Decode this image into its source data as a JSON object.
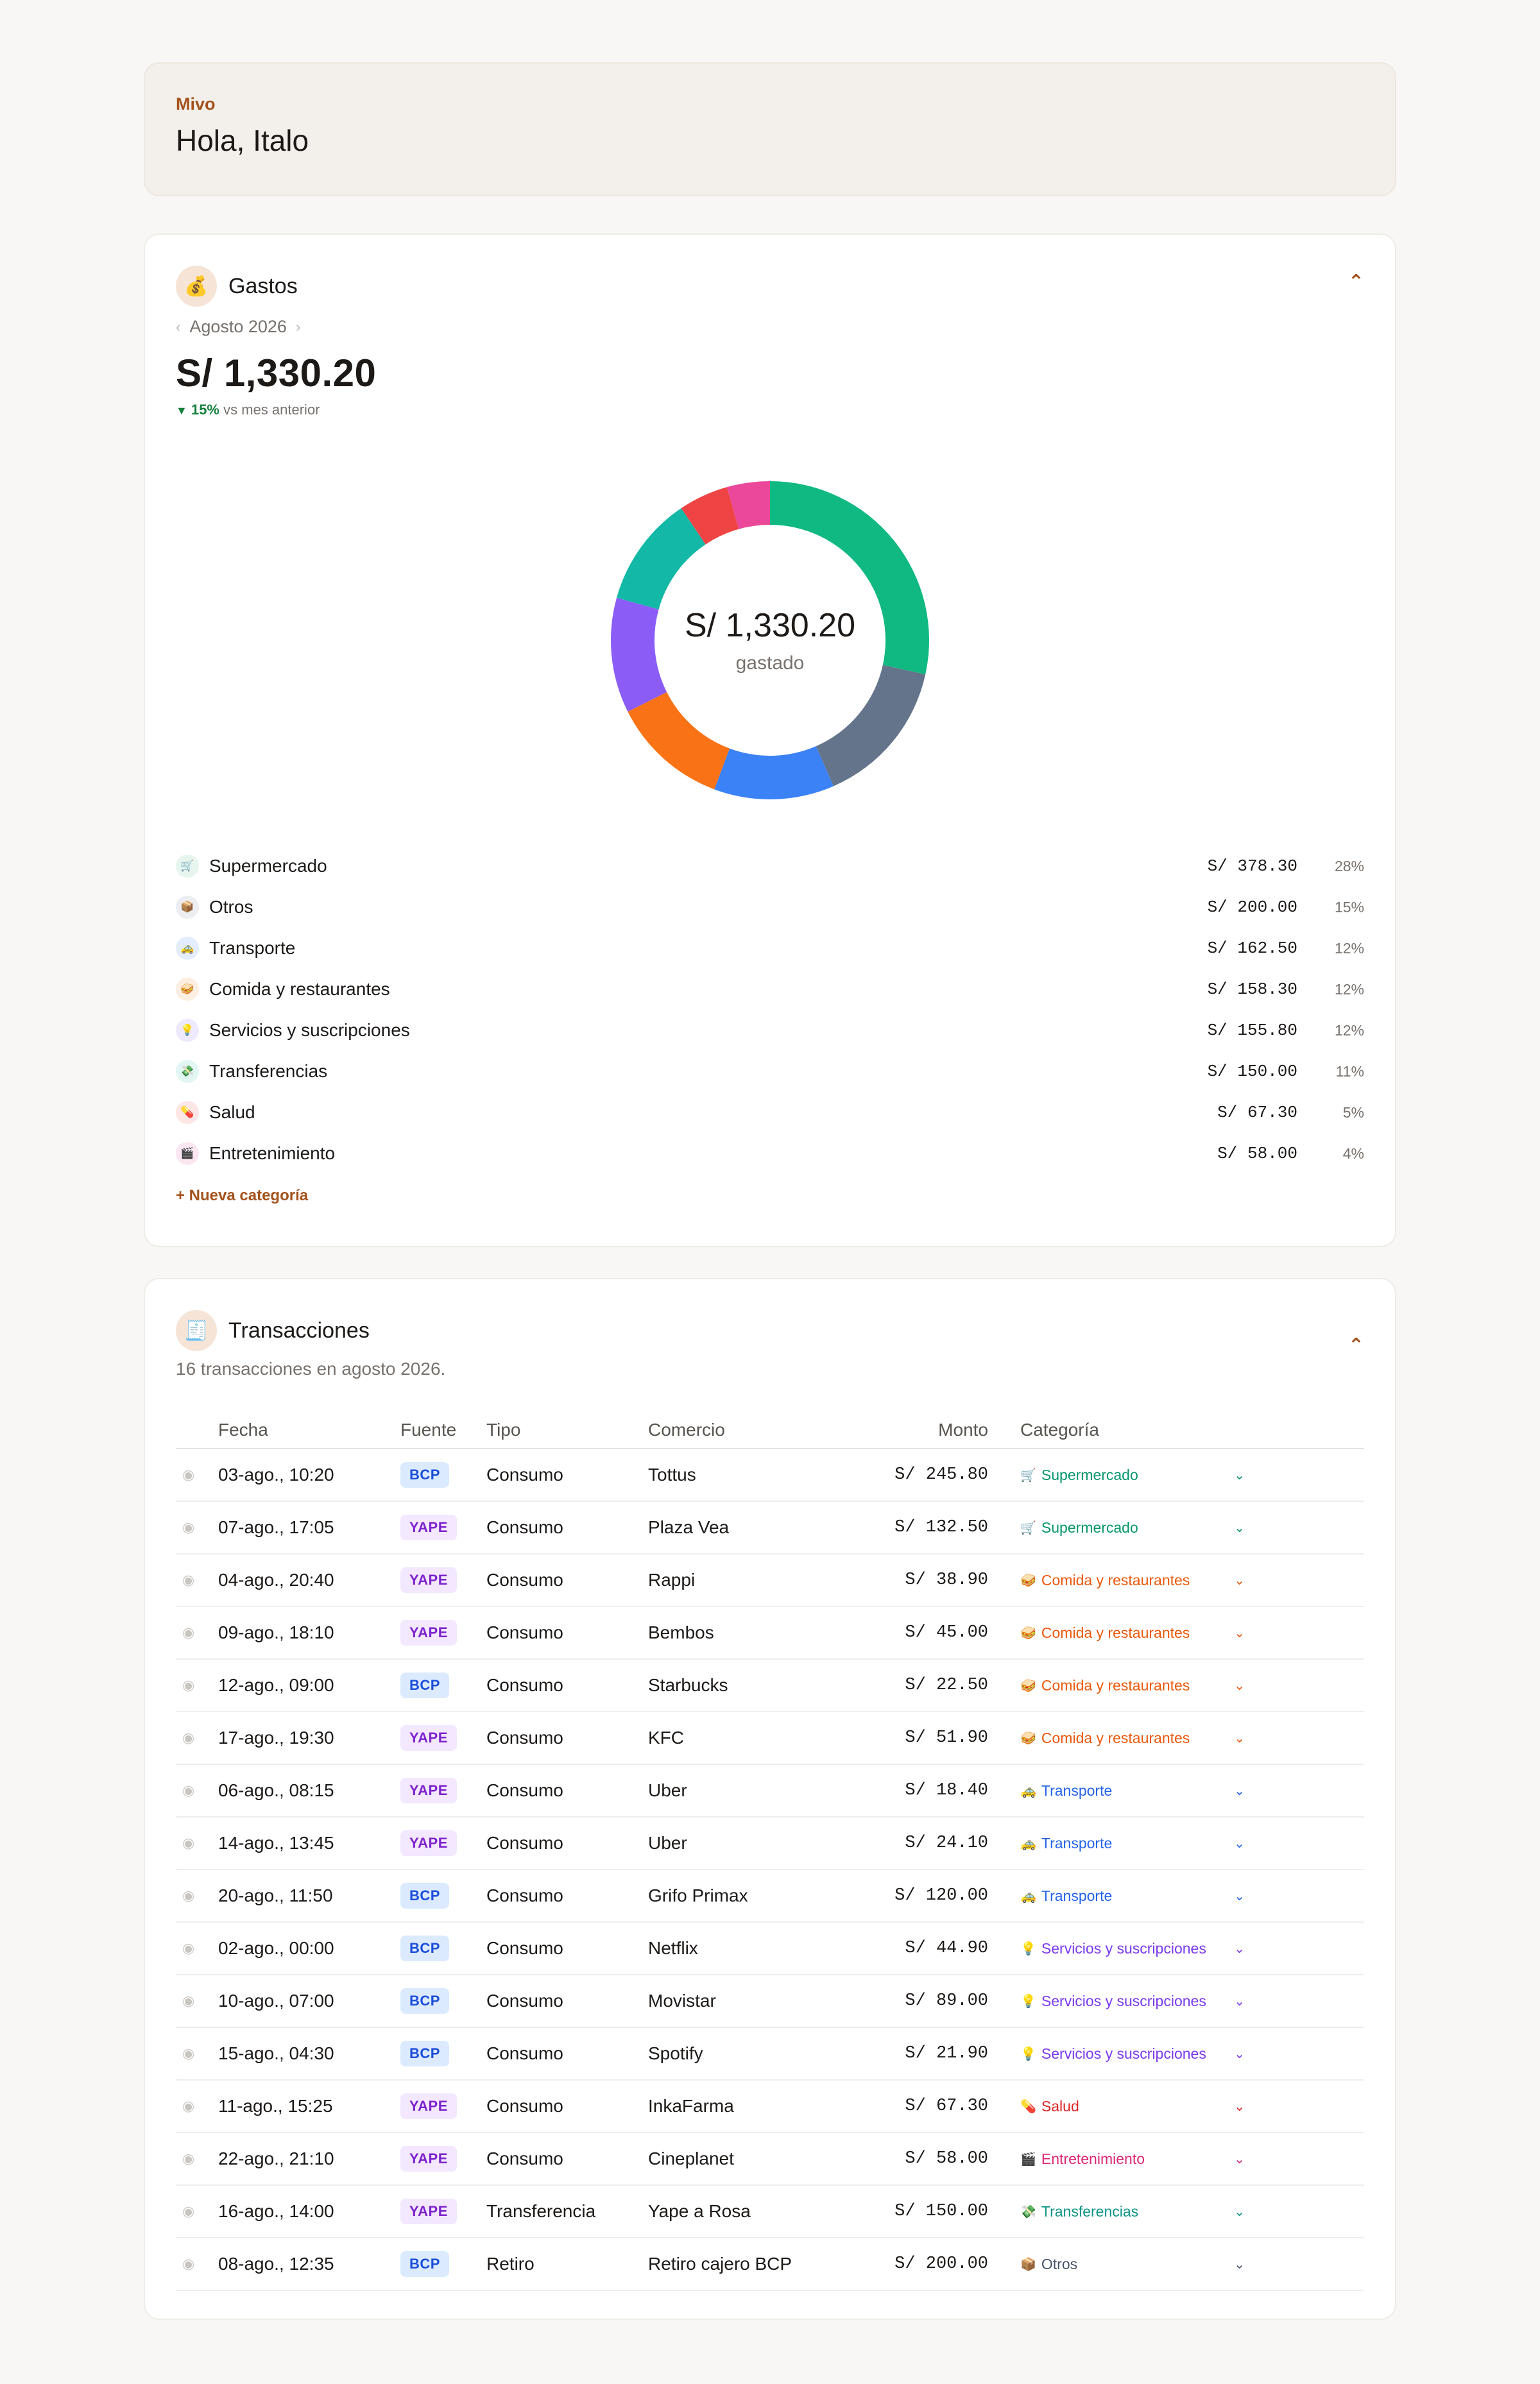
{
  "header": {
    "brand": "Mivo",
    "greeting": "Hola, Italo"
  },
  "gastos": {
    "icon": "money-bag-icon",
    "title": "Gastos",
    "period": "Agosto 2026",
    "total": "S/ 1,330.20",
    "delta_pct": "15%",
    "delta_label": "vs mes anterior",
    "donut_center_amount": "S/ 1,330.20",
    "donut_center_label": "gastado",
    "new_category": "+ Nueva categoría",
    "categories": [
      {
        "emoji": "🛒",
        "name": "Supermercado",
        "amount": "S/ 378.30",
        "pct": "28%",
        "color": "#10b981",
        "icon_bg": "#e6f6ef"
      },
      {
        "emoji": "📦",
        "name": "Otros",
        "amount": "S/ 200.00",
        "pct": "15%",
        "color": "#64748b",
        "icon_bg": "#eceef1"
      },
      {
        "emoji": "🚕",
        "name": "Transporte",
        "amount": "S/ 162.50",
        "pct": "12%",
        "color": "#3b82f6",
        "icon_bg": "#e4edfd"
      },
      {
        "emoji": "🥪",
        "name": "Comida y restaurantes",
        "amount": "S/ 158.30",
        "pct": "12%",
        "color": "#f97316",
        "icon_bg": "#fdeee2"
      },
      {
        "emoji": "💡",
        "name": "Servicios y suscripciones",
        "amount": "S/ 155.80",
        "pct": "12%",
        "color": "#8b5cf6",
        "icon_bg": "#efe9fd"
      },
      {
        "emoji": "💸",
        "name": "Transferencias",
        "amount": "S/ 150.00",
        "pct": "11%",
        "color": "#14b8a6",
        "icon_bg": "#e2f6f3"
      },
      {
        "emoji": "💊",
        "name": "Salud",
        "amount": "S/ 67.30",
        "pct": "5%",
        "color": "#ef4444",
        "icon_bg": "#fde6e6"
      },
      {
        "emoji": "🎬",
        "name": "Entretenimiento",
        "amount": "S/ 58.00",
        "pct": "4%",
        "color": "#ec4899",
        "icon_bg": "#fce7f1"
      }
    ]
  },
  "chart_data": {
    "type": "pie",
    "categories": [
      "Supermercado",
      "Otros",
      "Transporte",
      "Comida y restaurantes",
      "Servicios y suscripciones",
      "Transferencias",
      "Salud",
      "Entretenimiento"
    ],
    "values": [
      378.3,
      200.0,
      162.5,
      158.3,
      155.8,
      150.0,
      67.3,
      58.0
    ],
    "colors": [
      "#10b981",
      "#64748b",
      "#3b82f6",
      "#f97316",
      "#8b5cf6",
      "#14b8a6",
      "#ef4444",
      "#ec4899"
    ],
    "style": "donut"
  },
  "transacciones": {
    "icon": "receipt-icon",
    "title": "Transacciones",
    "subtitle": "16 transacciones en agosto 2026.",
    "columns": {
      "fecha": "Fecha",
      "fuente": "Fuente",
      "tipo": "Tipo",
      "comercio": "Comercio",
      "monto": "Monto",
      "categoria": "Categoría"
    },
    "rows": [
      {
        "fecha": "03-ago., 10:20",
        "fuente": "BCP",
        "tipo": "Consumo",
        "comercio": "Tottus",
        "monto": "S/ 245.80",
        "categoria": "Supermercado",
        "emoji": "🛒",
        "color": "#059669"
      },
      {
        "fecha": "07-ago., 17:05",
        "fuente": "YAPE",
        "tipo": "Consumo",
        "comercio": "Plaza Vea",
        "monto": "S/ 132.50",
        "categoria": "Supermercado",
        "emoji": "🛒",
        "color": "#059669"
      },
      {
        "fecha": "04-ago., 20:40",
        "fuente": "YAPE",
        "tipo": "Consumo",
        "comercio": "Rappi",
        "monto": "S/ 38.90",
        "categoria": "Comida y restaurantes",
        "emoji": "🥪",
        "color": "#ea580c"
      },
      {
        "fecha": "09-ago., 18:10",
        "fuente": "YAPE",
        "tipo": "Consumo",
        "comercio": "Bembos",
        "monto": "S/ 45.00",
        "categoria": "Comida y restaurantes",
        "emoji": "🥪",
        "color": "#ea580c"
      },
      {
        "fecha": "12-ago., 09:00",
        "fuente": "BCP",
        "tipo": "Consumo",
        "comercio": "Starbucks",
        "monto": "S/ 22.50",
        "categoria": "Comida y restaurantes",
        "emoji": "🥪",
        "color": "#ea580c"
      },
      {
        "fecha": "17-ago., 19:30",
        "fuente": "YAPE",
        "tipo": "Consumo",
        "comercio": "KFC",
        "monto": "S/ 51.90",
        "categoria": "Comida y restaurantes",
        "emoji": "🥪",
        "color": "#ea580c"
      },
      {
        "fecha": "06-ago., 08:15",
        "fuente": "YAPE",
        "tipo": "Consumo",
        "comercio": "Uber",
        "monto": "S/ 18.40",
        "categoria": "Transporte",
        "emoji": "🚕",
        "color": "#2563eb"
      },
      {
        "fecha": "14-ago., 13:45",
        "fuente": "YAPE",
        "tipo": "Consumo",
        "comercio": "Uber",
        "monto": "S/ 24.10",
        "categoria": "Transporte",
        "emoji": "🚕",
        "color": "#2563eb"
      },
      {
        "fecha": "20-ago., 11:50",
        "fuente": "BCP",
        "tipo": "Consumo",
        "comercio": "Grifo Primax",
        "monto": "S/ 120.00",
        "categoria": "Transporte",
        "emoji": "🚕",
        "color": "#2563eb"
      },
      {
        "fecha": "02-ago., 00:00",
        "fuente": "BCP",
        "tipo": "Consumo",
        "comercio": "Netflix",
        "monto": "S/ 44.90",
        "categoria": "Servicios y suscripciones",
        "emoji": "💡",
        "color": "#7c3aed"
      },
      {
        "fecha": "10-ago., 07:00",
        "fuente": "BCP",
        "tipo": "Consumo",
        "comercio": "Movistar",
        "monto": "S/ 89.00",
        "categoria": "Servicios y suscripciones",
        "emoji": "💡",
        "color": "#7c3aed"
      },
      {
        "fecha": "15-ago., 04:30",
        "fuente": "BCP",
        "tipo": "Consumo",
        "comercio": "Spotify",
        "monto": "S/ 21.90",
        "categoria": "Servicios y suscripciones",
        "emoji": "💡",
        "color": "#7c3aed"
      },
      {
        "fecha": "11-ago., 15:25",
        "fuente": "YAPE",
        "tipo": "Consumo",
        "comercio": "InkaFarma",
        "monto": "S/ 67.30",
        "categoria": "Salud",
        "emoji": "💊",
        "color": "#dc2626"
      },
      {
        "fecha": "22-ago., 21:10",
        "fuente": "YAPE",
        "tipo": "Consumo",
        "comercio": "Cineplanet",
        "monto": "S/ 58.00",
        "categoria": "Entretenimiento",
        "emoji": "🎬",
        "color": "#db2777"
      },
      {
        "fecha": "16-ago., 14:00",
        "fuente": "YAPE",
        "tipo": "Transferencia",
        "comercio": "Yape a Rosa",
        "monto": "S/ 150.00",
        "categoria": "Transferencias",
        "emoji": "💸",
        "color": "#0d9488"
      },
      {
        "fecha": "08-ago., 12:35",
        "fuente": "BCP",
        "tipo": "Retiro",
        "comercio": "Retiro cajero BCP",
        "monto": "S/ 200.00",
        "categoria": "Otros",
        "emoji": "📦",
        "color": "#475569"
      }
    ]
  }
}
